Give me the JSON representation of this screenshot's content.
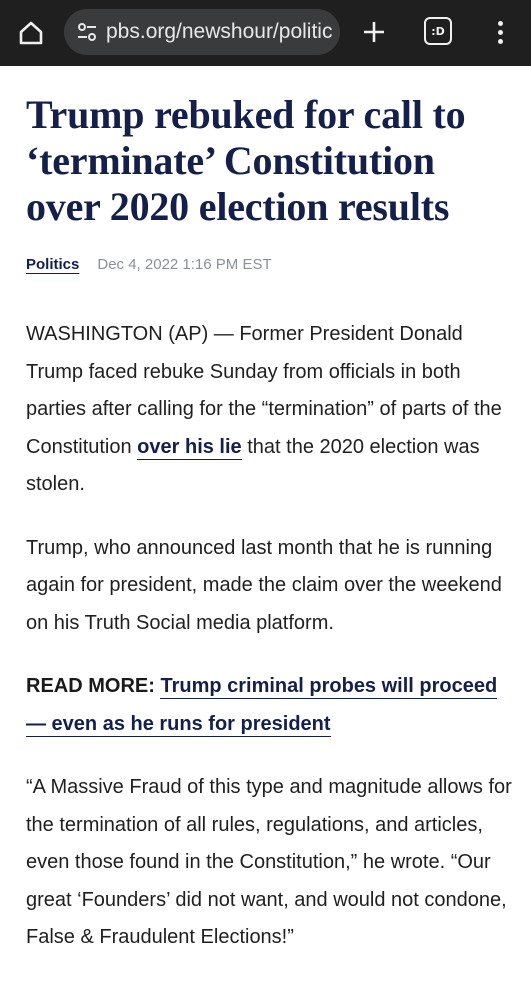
{
  "browser": {
    "url": "pbs.org/newshour/politic",
    "tab_count_label": ":D"
  },
  "article": {
    "headline": "Trump rebuked for call to ‘terminate’ Constitution over 2020 election results",
    "section": "Politics",
    "date": "Dec 4, 2022 1:16 PM EST",
    "p1_pre": "WASHINGTON (AP) — Former President Donald Trump faced rebuke Sunday from officials in both parties after calling for the “termination” of parts of the Constitution ",
    "p1_link": "over his lie",
    "p1_post": " that the 2020 election was stolen.",
    "p2": "Trump, who announced last month that he is running again for president, made the claim over the weekend on his Truth Social media platform.",
    "read_more_label": "READ MORE:",
    "read_more_link": "Trump criminal probes will proceed — even as he runs for president",
    "p3": "“A Massive Fraud of this type and magnitude allows for the termination of all rules, regulations, and articles, even those found in the Constitution,” he wrote. “Our great ‘Founders’ did not want, and would not condone, False & Fraudulent Elections!”"
  },
  "colors": {
    "chrome_bg": "#1f1f1f",
    "headline": "#14204a",
    "date": "#8a8f98"
  }
}
